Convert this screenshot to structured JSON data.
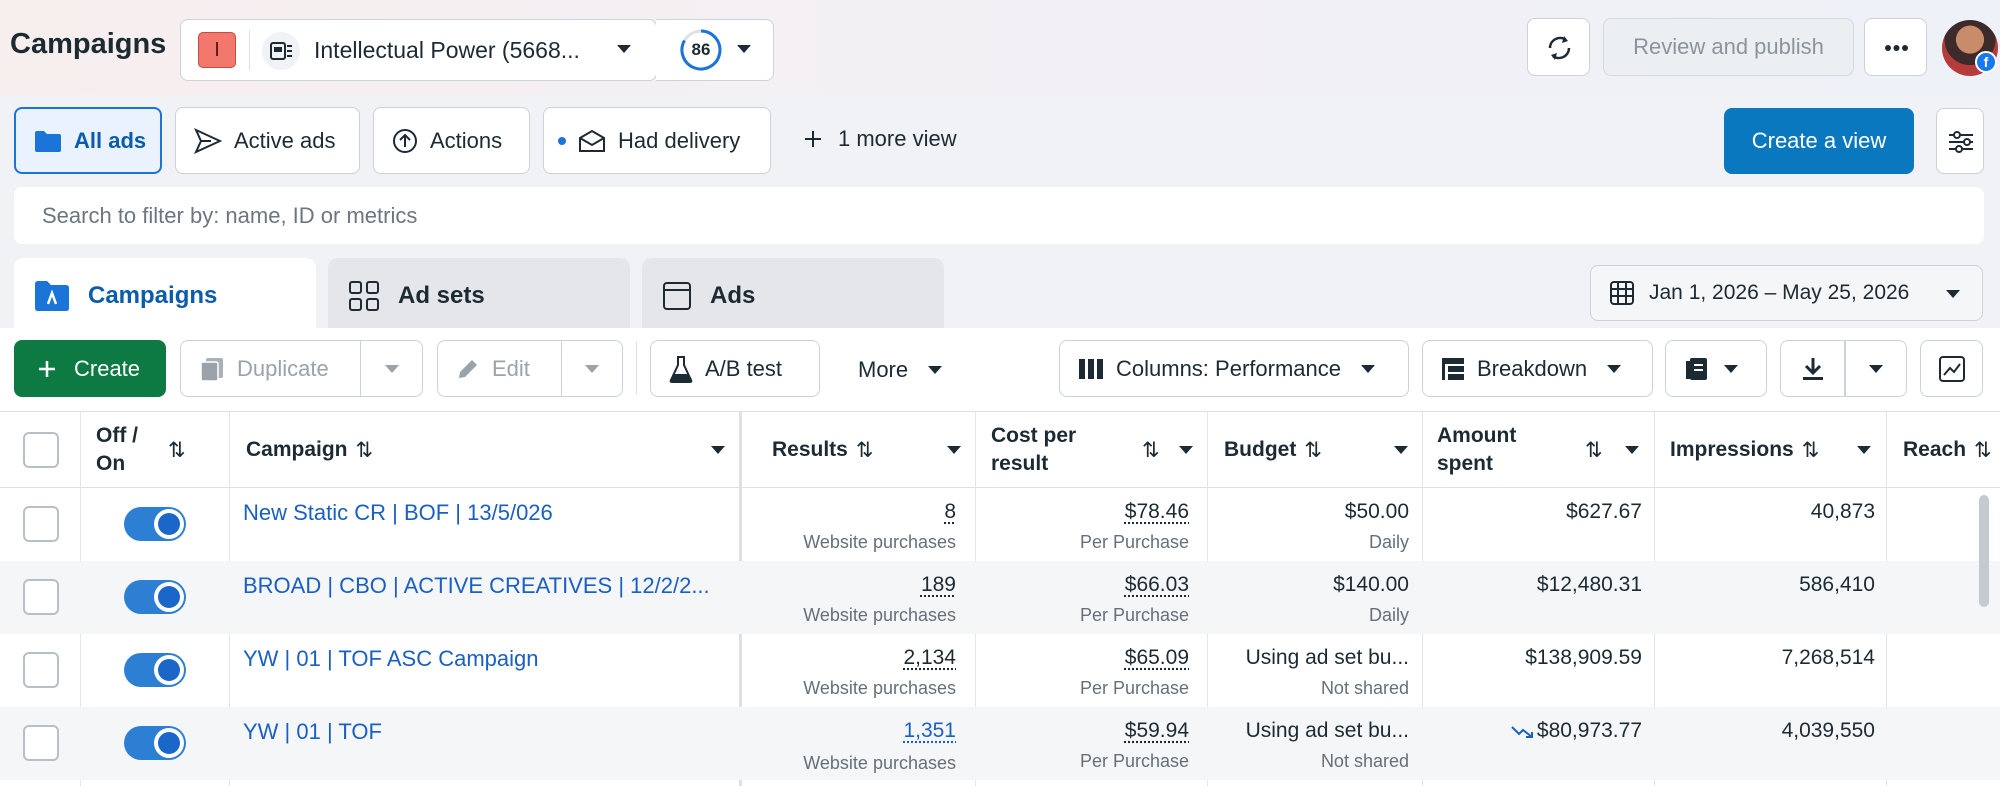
{
  "header": {
    "title": "Campaigns",
    "account_initial": "I",
    "account_name": "Intellectual Power (5668...",
    "score": "86",
    "review_publish": "Review and publish"
  },
  "views": {
    "items": [
      {
        "label": "All ads",
        "active": true
      },
      {
        "label": "Active ads"
      },
      {
        "label": "Actions"
      },
      {
        "label": "Had delivery"
      }
    ],
    "more_view": "1 more view",
    "create_view": "Create a view"
  },
  "search": {
    "placeholder": "Search to filter by: name, ID or metrics"
  },
  "tabs": [
    {
      "label": "Campaigns",
      "active": true
    },
    {
      "label": "Ad sets"
    },
    {
      "label": "Ads"
    }
  ],
  "date_range": "Jan 1, 2026 – May 25, 2026",
  "toolbar": {
    "create": "Create",
    "duplicate": "Duplicate",
    "edit": "Edit",
    "ab_test": "A/B test",
    "more": "More",
    "columns": "Columns: Performance",
    "breakdown": "Breakdown"
  },
  "table": {
    "headers": {
      "off_on": "Off / On",
      "campaign": "Campaign",
      "results": "Results",
      "cost_per_result": "Cost per result",
      "budget": "Budget",
      "amount_spent": "Amount spent",
      "impressions": "Impressions",
      "reach": "Reach"
    },
    "rows": [
      {
        "name": "New Static CR | BOF | 13/5/026",
        "results": "8",
        "results_sub": "Website purchases",
        "cpr": "$78.46",
        "cpr_sub": "Per Purchase",
        "budget": "$50.00",
        "budget_sub": "Daily",
        "spent": "$627.67",
        "impressions": "40,873"
      },
      {
        "name": "BROAD | CBO | ACTIVE CREATIVES | 12/2/2...",
        "results": "189",
        "results_sub": "Website purchases",
        "cpr": "$66.03",
        "cpr_sub": "Per Purchase",
        "budget": "$140.00",
        "budget_sub": "Daily",
        "spent": "$12,480.31",
        "impressions": "586,410"
      },
      {
        "name": "YW | 01 | TOF ASC Campaign",
        "results": "2,134",
        "results_sub": "Website purchases",
        "cpr": "$65.09",
        "cpr_sub": "Per Purchase",
        "budget": "Using ad set bu...",
        "budget_sub": "Not shared",
        "spent": "$138,909.59",
        "impressions": "7,268,514"
      },
      {
        "name": "YW | 01 | TOF",
        "results": "1,351",
        "results_sub": "Website purchases",
        "cpr": "$59.94",
        "cpr_sub": "Per Purchase",
        "budget": "Using ad set bu...",
        "budget_sub": "Not shared",
        "spent": "$80,973.77",
        "impressions": "4,039,550"
      }
    ]
  }
}
